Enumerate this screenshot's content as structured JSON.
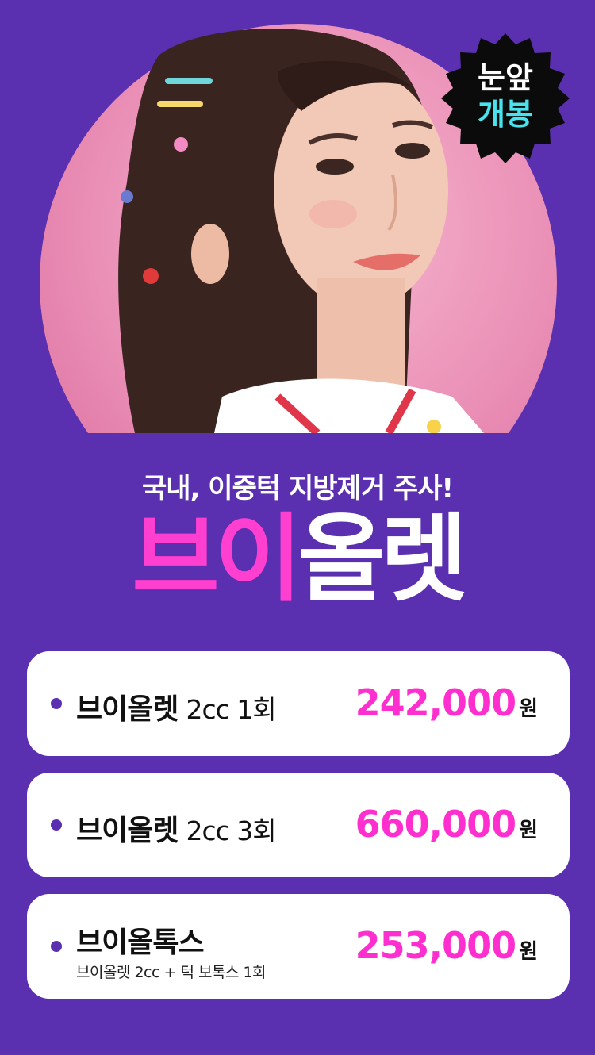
{
  "badge": {
    "line1": "눈앞",
    "line2": "개봉"
  },
  "hero": {
    "subtitle": "국내, 이중턱 지방제거 주사!",
    "title_part1": "브이",
    "title_part2": "올렛"
  },
  "prices": [
    {
      "name": "브이올렛",
      "spec": "2cc  1회",
      "note": "",
      "amount": "242,000",
      "unit": "원"
    },
    {
      "name": "브이올렛",
      "spec": "2cc  3회",
      "note": "",
      "amount": "660,000",
      "unit": "원"
    },
    {
      "name": "브이올톡스",
      "spec": "",
      "note": "브이올렛 2cc + 턱 보톡스 1회",
      "amount": "253,000",
      "unit": "원"
    }
  ],
  "colors": {
    "background": "#5a2fb0",
    "accent_pink": "#ff2fcf",
    "badge_text_cyan": "#49e3ee",
    "card": "#ffffff"
  }
}
